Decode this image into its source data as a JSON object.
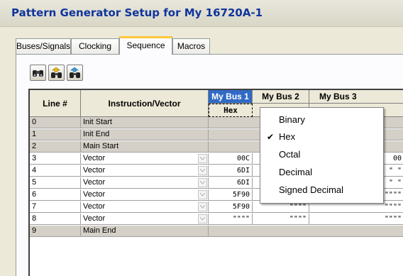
{
  "window": {
    "title": "Pattern Generator Setup for My 16720A-1"
  },
  "tabs": [
    {
      "label": "Buses/Signals",
      "active": false
    },
    {
      "label": "Clocking",
      "active": false
    },
    {
      "label": "Sequence",
      "active": true
    },
    {
      "label": "Macros",
      "active": false
    }
  ],
  "toolbar": {
    "buttons": [
      {
        "icon": "binoculars-icon"
      },
      {
        "icon": "find-previous-icon"
      },
      {
        "icon": "find-next-icon"
      }
    ]
  },
  "grid": {
    "headers": {
      "line": "Line #",
      "instruction": "Instruction/Vector",
      "bus1": "My Bus 1",
      "bus2": "My Bus 2",
      "bus3": "My Bus 3"
    },
    "bus1_format": "Hex",
    "rows": [
      {
        "line": "0",
        "instruction": "Init Start",
        "kind": "label",
        "bus1": "",
        "bus2": "",
        "bus3": ""
      },
      {
        "line": "1",
        "instruction": "Init End",
        "kind": "label",
        "bus1": "",
        "bus2": "",
        "bus3": ""
      },
      {
        "line": "2",
        "instruction": "Main Start",
        "kind": "label",
        "bus1": "",
        "bus2": "",
        "bus3": ""
      },
      {
        "line": "3",
        "instruction": "Vector",
        "kind": "vector",
        "bus1": "00C",
        "bus2": "",
        "bus3": "00"
      },
      {
        "line": "4",
        "instruction": "Vector",
        "kind": "vector",
        "bus1": "6DI",
        "bus2": "",
        "bus3": "\" \""
      },
      {
        "line": "5",
        "instruction": "Vector",
        "kind": "vector",
        "bus1": "6DI",
        "bus2": "",
        "bus3": "\" \""
      },
      {
        "line": "6",
        "instruction": "Vector",
        "kind": "vector",
        "bus1": "5F90",
        "bus2": "\"\"\"\"",
        "bus3": "\"\"\"\""
      },
      {
        "line": "7",
        "instruction": "Vector",
        "kind": "vector",
        "bus1": "5F90",
        "bus2": "\"\"\"\"",
        "bus3": "\"\"\"\""
      },
      {
        "line": "8",
        "instruction": "Vector",
        "kind": "vector",
        "bus1": "\"\"\"\"",
        "bus2": "\"\"\"\"",
        "bus3": "\"\"\"\""
      },
      {
        "line": "9",
        "instruction": "Main End",
        "kind": "label",
        "bus1": "",
        "bus2": "",
        "bus3": ""
      }
    ]
  },
  "context_menu": {
    "items": [
      {
        "label": "Binary",
        "checked": false
      },
      {
        "label": "Hex",
        "checked": true
      },
      {
        "label": "Octal",
        "checked": false
      },
      {
        "label": "Decimal",
        "checked": false
      },
      {
        "label": "Signed Decimal",
        "checked": false
      }
    ],
    "check_glyph": "✔"
  },
  "colors": {
    "title_text": "#10359c",
    "selected_header": "#316ac5",
    "active_tab_accent": "#ffc83c",
    "label_row_fill": "#d4d0c8"
  }
}
